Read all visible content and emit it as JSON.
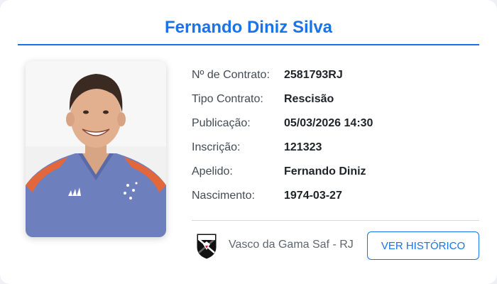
{
  "card": {
    "title": "Fernando Diniz Silva"
  },
  "photo": {
    "icon": "player-photo"
  },
  "details": [
    {
      "label": "Nº de Contrato:",
      "value": "2581793RJ"
    },
    {
      "label": "Tipo Contrato:",
      "value": "Rescisão"
    },
    {
      "label": "Publicação:",
      "value": "05/03/2026 14:30"
    },
    {
      "label": "Inscrição:",
      "value": "121323"
    },
    {
      "label": "Apelido:",
      "value": "Fernando Diniz"
    },
    {
      "label": "Nascimento:",
      "value": "1974-03-27"
    }
  ],
  "club": {
    "name": "Vasco da Gama Saf - RJ",
    "crest_icon": "vasco-crest-icon"
  },
  "actions": {
    "history_label": "VER HISTÓRICO"
  },
  "colors": {
    "accent": "#1a73e8",
    "card_background": "#ffffff",
    "page_background": "#eef0f3",
    "label_text": "#444b55",
    "value_text": "#1f2328",
    "muted_text": "#5f6670",
    "divider": "#d7d9dd"
  }
}
